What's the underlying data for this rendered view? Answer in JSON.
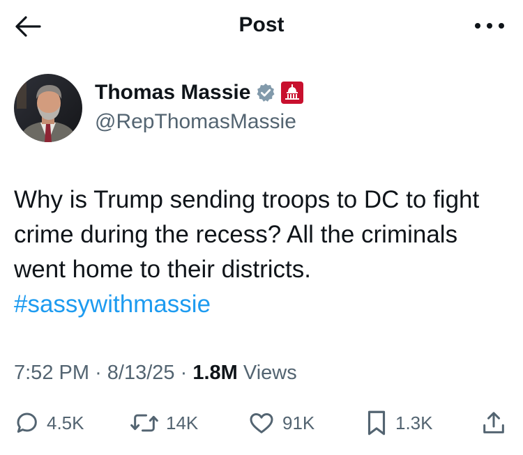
{
  "header": {
    "title": "Post",
    "back_icon": "arrow-left-icon",
    "more_icon": "more-horizontal-icon"
  },
  "author": {
    "name": "Thomas Massie",
    "handle": "@RepThomasMassie",
    "verified_icon": "verified-badge-icon",
    "affiliation_icon": "us-capitol-icon",
    "verified_color": "#829aab",
    "affiliation_color": "#c8102e"
  },
  "tweet": {
    "text": "Why is Trump sending troops to DC to fight crime during the recess? All the criminals went home to their districts.",
    "hashtag": "#sassywithmassie"
  },
  "meta": {
    "time": "7:52 PM",
    "date": "8/13/25",
    "views_count": "1.8M",
    "views_label": "Views",
    "separator": "·"
  },
  "actions": {
    "reply": {
      "icon": "reply-icon",
      "count": "4.5K"
    },
    "repost": {
      "icon": "repost-icon",
      "count": "14K"
    },
    "like": {
      "icon": "heart-icon",
      "count": "91K"
    },
    "bookmark": {
      "icon": "bookmark-icon",
      "count": "1.3K"
    },
    "share": {
      "icon": "share-icon"
    }
  },
  "colors": {
    "text": "#0f1419",
    "secondary": "#536471",
    "link": "#1d9bf0"
  }
}
